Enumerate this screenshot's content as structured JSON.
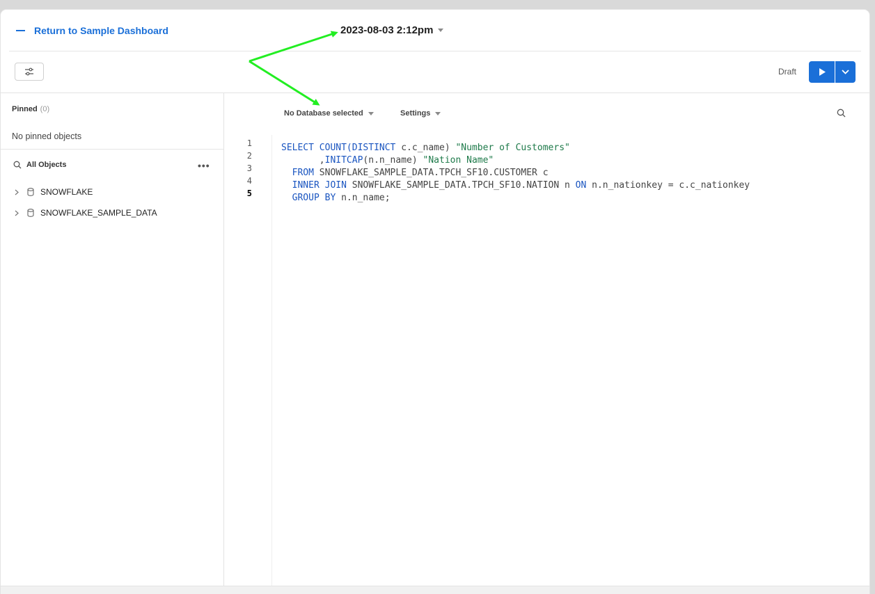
{
  "header": {
    "back_label": "Return to Sample Dashboard",
    "worksheet_title": "2023-08-03 2:12pm"
  },
  "toolbar": {
    "status": "Draft"
  },
  "sidebar": {
    "pinned_label": "Pinned",
    "pinned_count": "(0)",
    "no_pinned_text": "No pinned objects",
    "all_objects_label": "All Objects",
    "databases": [
      {
        "name": "SNOWFLAKE"
      },
      {
        "name": "SNOWFLAKE_SAMPLE_DATA"
      }
    ]
  },
  "editor": {
    "database_selector": "No Database selected",
    "settings_label": "Settings",
    "line_numbers": [
      "1",
      "2",
      "3",
      "4",
      "5"
    ],
    "lines": [
      [
        {
          "t": "SELECT ",
          "k": "kw"
        },
        {
          "t": "COUNT(",
          "k": "kw"
        },
        {
          "t": "DISTINCT",
          "k": "kw"
        },
        {
          "t": " c.c_name) ",
          "k": "plain"
        },
        {
          "t": "\"Number of Customers\"",
          "k": "str"
        }
      ],
      [
        {
          "t": "       ,",
          "k": "plain"
        },
        {
          "t": "INITCAP",
          "k": "kw"
        },
        {
          "t": "(n.n_name) ",
          "k": "plain"
        },
        {
          "t": "\"Nation Name\"",
          "k": "str"
        }
      ],
      [
        {
          "t": "  ",
          "k": "plain"
        },
        {
          "t": "FROM",
          "k": "kw"
        },
        {
          "t": " SNOWFLAKE_SAMPLE_DATA.TPCH_SF10.CUSTOMER c",
          "k": "plain"
        }
      ],
      [
        {
          "t": "  ",
          "k": "plain"
        },
        {
          "t": "INNER JOIN",
          "k": "kw"
        },
        {
          "t": " SNOWFLAKE_SAMPLE_DATA.TPCH_SF10.NATION n ",
          "k": "plain"
        },
        {
          "t": "ON",
          "k": "kw"
        },
        {
          "t": " n.n_nationkey = c.c_nationkey",
          "k": "plain"
        }
      ],
      [
        {
          "t": "  ",
          "k": "plain"
        },
        {
          "t": "GROUP BY",
          "k": "kw"
        },
        {
          "t": " n.n_name;",
          "k": "plain"
        }
      ]
    ]
  },
  "colors": {
    "accent": "#1a6fd8",
    "keyword": "#1a55c0",
    "string": "#1e7a4a",
    "annotation_arrow": "#22ee22"
  }
}
